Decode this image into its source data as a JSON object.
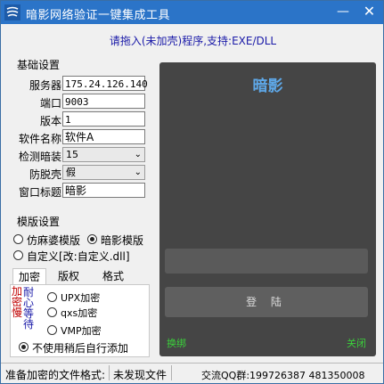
{
  "window": {
    "title": "暗影网络验证一键集成工具",
    "minimize": "—",
    "close": "✕",
    "icon": "app-logo-icon"
  },
  "hint": "请拖入(未加壳)程序,支持:EXE/DLL",
  "basic": {
    "title": "基础设置",
    "server_label": "服务器",
    "server_value": "175.24.126.140",
    "port_label": "端口",
    "port_value": "9003",
    "version_label": "版本",
    "version_value": "1",
    "software_label": "软件名称",
    "software_value": "软件A",
    "detect_label": "检测暗装",
    "detect_value": "15",
    "anti_label": "防脱壳",
    "anti_value": "假",
    "wintitle_label": "窗口标题",
    "wintitle_value": "暗影"
  },
  "template": {
    "title": "模版设置",
    "opt1": "仿麻婆模版",
    "opt2": "暗影模版",
    "opt3": "自定义[改:自定义.dll]",
    "selected": "opt2"
  },
  "tabs": [
    "加密",
    "版权",
    "格式"
  ],
  "encrypt": {
    "vert1": [
      "加",
      "密",
      "慢"
    ],
    "vert2": [
      "耐",
      "心",
      "等",
      "待"
    ],
    "opt_upx": "UPX加密",
    "opt_qxs": "qxs加密",
    "opt_vmp": "VMP加密",
    "opt_none": "不使用稍后自行添加",
    "selected": "opt_none"
  },
  "preview": {
    "title": "暗影",
    "login": "登 陆",
    "unbind": "换绑",
    "close": "关闭",
    "accent": "#5ea8e8",
    "link_color": "#3bd13b"
  },
  "status": {
    "label": "准备加密的文件格式:",
    "value": "未发现文件",
    "qq": "交流QQ群:199726387   481350008"
  }
}
